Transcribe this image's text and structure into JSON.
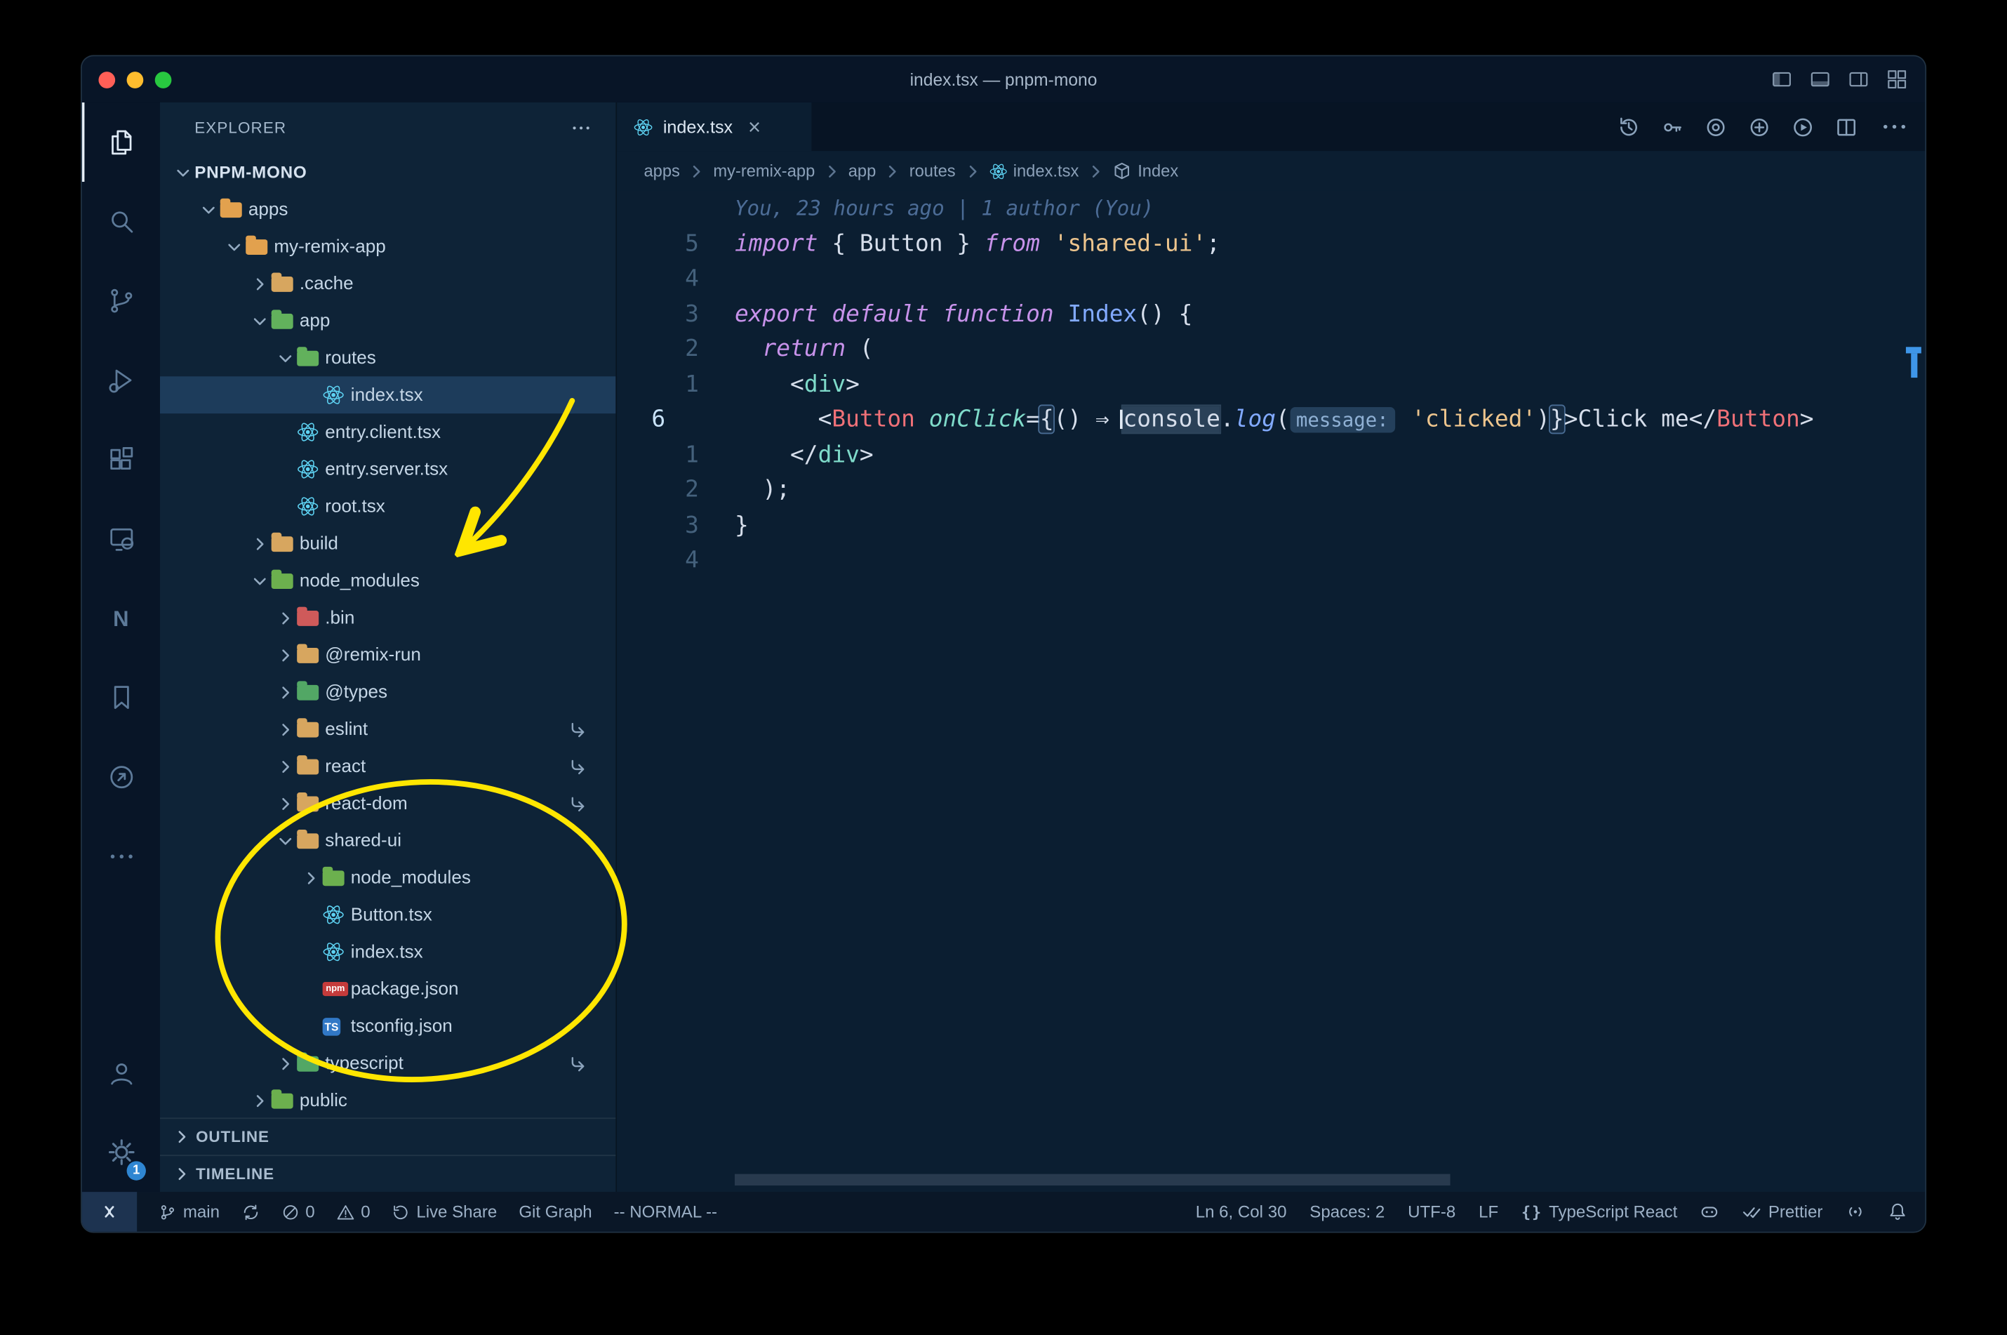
{
  "colors": {
    "annotation_yellow": "#ffe600",
    "overview_ruler_blue": "#3f96e8",
    "keyword": "#c792ea",
    "string": "#ecc48d",
    "function_name": "#82aaff",
    "jsx_component": "#f07178",
    "jsx_tag": "#7fdbca",
    "selected_row": "#1d3c5b"
  },
  "window": {
    "title": "index.tsx — pnpm-mono",
    "controls": [
      "close",
      "minimize",
      "zoom"
    ],
    "layout_icons": [
      "layout-sidebar-icon",
      "layout-panel-icon",
      "layout-secondary-sidebar-icon",
      "layout-grid-icon"
    ]
  },
  "activity_bar": {
    "top": [
      {
        "icon": "files",
        "active": true
      },
      {
        "icon": "search"
      },
      {
        "icon": "source-control"
      },
      {
        "icon": "run-debug"
      },
      {
        "icon": "extensions"
      },
      {
        "icon": "live-preview"
      },
      {
        "icon": "nx-console"
      },
      {
        "icon": "bookmarks"
      },
      {
        "icon": "code-runner"
      },
      {
        "icon": "more"
      }
    ],
    "bottom": [
      {
        "icon": "account"
      },
      {
        "icon": "settings",
        "badge": "1"
      }
    ]
  },
  "sidebar": {
    "header": "EXPLORER",
    "sections": [
      {
        "label": "OUTLINE"
      },
      {
        "label": "TIMELINE"
      }
    ],
    "tree": [
      {
        "label": "PNPM-MONO",
        "level": 0,
        "chevron": "down",
        "root": true
      },
      {
        "label": "apps",
        "level": 1,
        "chevron": "down",
        "icon": "folder",
        "color": "#e2a14e"
      },
      {
        "label": "my-remix-app",
        "level": 2,
        "chevron": "down",
        "icon": "folder",
        "color": "#e2a14e"
      },
      {
        "label": ".cache",
        "level": 3,
        "chevron": "right",
        "icon": "folder",
        "color": "#d7a65f"
      },
      {
        "label": "app",
        "level": 3,
        "chevron": "down",
        "icon": "folder",
        "color": "#62b15c"
      },
      {
        "label": "routes",
        "level": 4,
        "chevron": "down",
        "icon": "folder",
        "color": "#62b15c"
      },
      {
        "label": "index.tsx",
        "level": 5,
        "icon": "react",
        "selected": true
      },
      {
        "label": "entry.client.tsx",
        "level": 4,
        "icon": "react"
      },
      {
        "label": "entry.server.tsx",
        "level": 4,
        "icon": "react"
      },
      {
        "label": "root.tsx",
        "level": 4,
        "icon": "react"
      },
      {
        "label": "build",
        "level": 3,
        "chevron": "right",
        "icon": "folder",
        "color": "#d7a65f"
      },
      {
        "label": "node_modules",
        "level": 3,
        "chevron": "down",
        "icon": "folder",
        "color": "#6cb04e"
      },
      {
        "label": ".bin",
        "level": 4,
        "chevron": "right",
        "icon": "folder",
        "color": "#cf5a5a"
      },
      {
        "label": "@remix-run",
        "level": 4,
        "chevron": "right",
        "icon": "folder",
        "color": "#d7a65f"
      },
      {
        "label": "@types",
        "level": 4,
        "chevron": "right",
        "icon": "folder",
        "color": "#52a765"
      },
      {
        "label": "eslint",
        "level": 4,
        "chevron": "right",
        "icon": "folder",
        "color": "#d7a65f",
        "symlink": true
      },
      {
        "label": "react",
        "level": 4,
        "chevron": "right",
        "icon": "folder",
        "color": "#d7a65f",
        "symlink": true
      },
      {
        "label": "react-dom",
        "level": 4,
        "chevron": "right",
        "icon": "folder",
        "color": "#d7a65f",
        "symlink": true
      },
      {
        "label": "shared-ui",
        "level": 4,
        "chevron": "down",
        "icon": "folder",
        "color": "#d7a65f"
      },
      {
        "label": "node_modules",
        "level": 5,
        "chevron": "right",
        "icon": "folder",
        "color": "#6cb04e"
      },
      {
        "label": "Button.tsx",
        "level": 5,
        "icon": "react"
      },
      {
        "label": "index.tsx",
        "level": 5,
        "icon": "react"
      },
      {
        "label": "package.json",
        "level": 5,
        "icon": "npm"
      },
      {
        "label": "tsconfig.json",
        "level": 5,
        "icon": "ts"
      },
      {
        "label": "typescript",
        "level": 4,
        "chevron": "right",
        "icon": "folder",
        "color": "#52a765",
        "symlink": true
      },
      {
        "label": "public",
        "level": 3,
        "chevron": "right",
        "icon": "folder",
        "color": "#6cb04e"
      }
    ]
  },
  "editor": {
    "tabs": [
      {
        "label": "index.tsx",
        "icon": "react",
        "active": true,
        "close_glyph": "×"
      }
    ],
    "actions": [
      "history",
      "gitlens",
      "compare",
      "open-changes",
      "run",
      "split-editor",
      "more"
    ],
    "breadcrumbs": [
      {
        "label": "apps"
      },
      {
        "label": "my-remix-app"
      },
      {
        "label": "app"
      },
      {
        "label": "routes"
      },
      {
        "label": "index.tsx",
        "icon": "react"
      },
      {
        "label": "Index",
        "icon": "symbol"
      }
    ],
    "blame": "You, 23 hours ago | 1 author (You)",
    "lines": [
      {
        "n": "5",
        "t": [
          [
            "import",
            "kw"
          ],
          [
            " { ",
            "p"
          ],
          [
            "Button",
            "v"
          ],
          [
            " } ",
            "p"
          ],
          [
            "from",
            "kw"
          ],
          [
            " ",
            "p"
          ],
          [
            "'shared-ui'",
            "str"
          ],
          [
            ";",
            "p"
          ]
        ]
      },
      {
        "n": "4",
        "t": []
      },
      {
        "n": "3",
        "t": [
          [
            "export",
            "kw"
          ],
          [
            " ",
            "p"
          ],
          [
            "default",
            "kw"
          ],
          [
            " ",
            "p"
          ],
          [
            "function",
            "kw"
          ],
          [
            " ",
            "p"
          ],
          [
            "Index",
            "fn"
          ],
          [
            "() {",
            "p"
          ]
        ]
      },
      {
        "n": "2",
        "t": [
          [
            "  ",
            "p"
          ],
          [
            "return",
            "kw"
          ],
          [
            " (",
            "p"
          ]
        ]
      },
      {
        "n": "1",
        "t": [
          [
            "    <",
            "p"
          ],
          [
            "div",
            "tag"
          ],
          [
            ">",
            "p"
          ]
        ]
      },
      {
        "n": "6",
        "cur": true,
        "t": [
          [
            "      <",
            "p"
          ],
          [
            "Button",
            "cmp"
          ],
          [
            " ",
            "p"
          ],
          [
            "onClick",
            "attr"
          ],
          [
            "=",
            "p"
          ],
          [
            "{",
            "brhl"
          ],
          [
            "() ",
            "p"
          ],
          [
            "⇒",
            "op"
          ],
          [
            " ",
            "p"
          ],
          [
            "console",
            "whl cur p"
          ],
          [
            ".",
            "p"
          ],
          [
            "log",
            "fni"
          ],
          [
            "(",
            "p"
          ],
          [
            "message:",
            "inlay"
          ],
          [
            " ",
            "p"
          ],
          [
            "'clicked'",
            "str"
          ],
          [
            ")",
            "p"
          ],
          [
            "}",
            "brhl"
          ],
          [
            ">",
            "p"
          ],
          [
            "Click me",
            "p"
          ],
          [
            "</",
            "p"
          ],
          [
            "Button",
            "cmp"
          ],
          [
            ">",
            "p"
          ]
        ]
      },
      {
        "n": "1",
        "t": [
          [
            "    </",
            "p"
          ],
          [
            "div",
            "tag"
          ],
          [
            ">",
            "p"
          ]
        ]
      },
      {
        "n": "2",
        "t": [
          [
            "  );",
            "p"
          ]
        ]
      },
      {
        "n": "3",
        "t": [
          [
            "}",
            "p"
          ]
        ]
      },
      {
        "n": "4",
        "t": []
      }
    ]
  },
  "status_bar": {
    "left": [
      {
        "icon": "remote"
      },
      {
        "icon": "branch",
        "label": "main"
      },
      {
        "icon": "sync"
      },
      {
        "icon": "errors",
        "label": "0"
      },
      {
        "icon": "warnings",
        "label": "0"
      },
      {
        "icon": "live-share",
        "label": "Live Share"
      },
      {
        "label": "Git Graph"
      },
      {
        "label": "-- NORMAL --"
      }
    ],
    "right": [
      {
        "label": "Ln 6, Col 30"
      },
      {
        "label": "Spaces: 2"
      },
      {
        "label": "UTF-8"
      },
      {
        "label": "LF"
      },
      {
        "icon": "braces",
        "label": "TypeScript React"
      },
      {
        "icon": "copilot"
      },
      {
        "icon": "check-double",
        "label": "Prettier"
      },
      {
        "icon": "broadcast"
      },
      {
        "icon": "bell"
      }
    ]
  }
}
